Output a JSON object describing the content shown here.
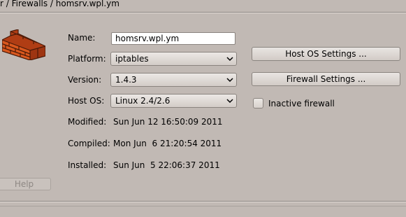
{
  "breadcrumb": "r / Firewalls / homsrv.wpl.ym",
  "form": {
    "name_label": "Name:",
    "name_value": "homsrv.wpl.ym",
    "platform_label": "Platform:",
    "platform_value": "iptables",
    "version_label": "Version:",
    "version_value": "1.4.3",
    "hostos_label": "Host OS:",
    "hostos_value": "Linux 2.4/2.6",
    "modified_label": "Modified:",
    "modified_value": "Sun Jun 12 16:50:09 2011",
    "compiled_label": "Compiled:",
    "compiled_value": "Mon Jun  6 21:20:54 2011",
    "installed_label": "Installed:",
    "installed_value": "Sun Jun  5 22:06:37 2011"
  },
  "buttons": {
    "host_os_settings": "Host OS Settings ...",
    "firewall_settings": "Firewall Settings ...",
    "help": "Help"
  },
  "inactive_firewall": {
    "label": "Inactive firewall",
    "checked": false
  },
  "icons": {
    "logo": "brick-wall-icon",
    "dropdown": "chevron-down-icon"
  },
  "colors": {
    "background": "#c1b9b4",
    "brick": "#d2541d"
  }
}
